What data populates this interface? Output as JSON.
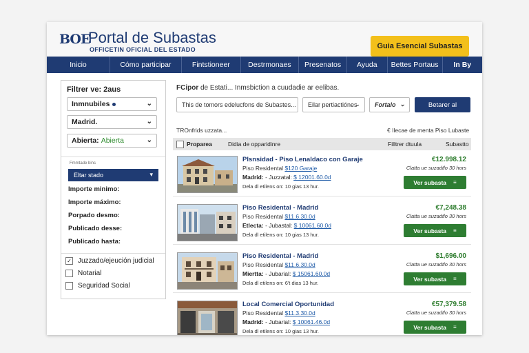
{
  "header": {
    "logo_mark": "BOE",
    "title": "Portal de Subastas",
    "subtitle": "OFFICETIN OFICIAL DEL ESTADO",
    "guide_button": "Guia Esencial Subastas"
  },
  "nav": {
    "items": [
      "Inicio",
      "Cómo participar",
      "Fintstioneer",
      "Destrmonaes",
      "Presenatos",
      "Ayuda",
      "Bettes Portaus",
      "In By"
    ]
  },
  "sidebar": {
    "title": "Filtrer ve: 2aus",
    "selects": [
      {
        "label": "Inmnubiles",
        "extra": ""
      },
      {
        "label": "Madrid.",
        "extra": ""
      },
      {
        "label": "Abierta:",
        "extra": "Abierta"
      }
    ],
    "small_label": "Fmmtade bins",
    "status_dropdown": "Eltar stado",
    "filters": [
      "Importe minimo:",
      "Importe máximo:",
      "Porpado desmo:",
      "Publicado desse:",
      "Publicado hasta:"
    ],
    "checkboxes": [
      {
        "label": "Juzzado/ejeución judicial",
        "checked": true
      },
      {
        "label": "Notarial",
        "checked": false
      },
      {
        "label": "Seguridad Social",
        "checked": false
      }
    ]
  },
  "search": {
    "label_bold": "FCipor",
    "label_rest": " de Estati... Inmsbiction a cuudadie ar eelibas.",
    "text_input": "This de tomors edelucfons de Subastes...",
    "select_1": "Eilar pertiactiónes",
    "select_2": "Fortalo",
    "button": "Betarer al"
  },
  "results": {
    "count_text": "TROnfrids uzzata...",
    "sort_links": "€ Ilecae de menta  Piso Lubaste",
    "columns": [
      "Proparea",
      "Didia de opparidinre",
      "Filltrer dtuula",
      "Subastto"
    ]
  },
  "listings": [
    {
      "title": "Plsnsidad - Piso Lenaldaco con Garaje",
      "type_label": "Piso Residental",
      "type_value": "$120 Garaje",
      "loc_label": "Madrid:",
      "loc_rest": " - Juzzatal: ",
      "loc_value": "$ 12001.60.0d",
      "time": "Dela dl etilens on: 10 gias 13 hur.",
      "price": "€12.998.12",
      "ends": "Clatta ue suzadtlo 30 hors",
      "button": "Ver subasta",
      "thumb": "a"
    },
    {
      "title": "Piso Residental - Madrid",
      "type_label": "Piso Residental",
      "type_value": "$11.6.30.0d",
      "loc_label": "Etlecta:",
      "loc_rest": " - Jubastal: ",
      "loc_value": "$ 10061.60.0d",
      "time": "Dela dl etilens on: 10 gias 13 hur.",
      "price": "€7,248.38",
      "ends": "Clatta ue suzadtlo 30 hors",
      "button": "Ver subasta",
      "thumb": "b"
    },
    {
      "title": "Piso Residental - Madrid",
      "type_label": "Piso Residental",
      "type_value": "$11.6.30.0d",
      "loc_label": "Miertta:",
      "loc_rest": " - Jubarial: ",
      "loc_value": "$ 15061.60.0d",
      "time": "Dela dl etilens on: 6't dias 13 hur.",
      "price": "$1,696.00",
      "ends": "Clatta ue suzadtlo 30 hors",
      "button": "Ver subasta",
      "thumb": "c"
    },
    {
      "title": "Local Comercial Oportunidad",
      "type_label": "Piso Residental",
      "type_value": "$11.3.30.0d",
      "loc_label": "Madrid:",
      "loc_rest": " - Jubarial: ",
      "loc_value": "$ 10061.46.0d",
      "time": "Dela dl etilens on: 10 gias 13 hur.",
      "price": "€57,379.58",
      "ends": "Clatta ue suzadtlo 30 hors",
      "button": "Ver subasta",
      "thumb": "d"
    }
  ]
}
